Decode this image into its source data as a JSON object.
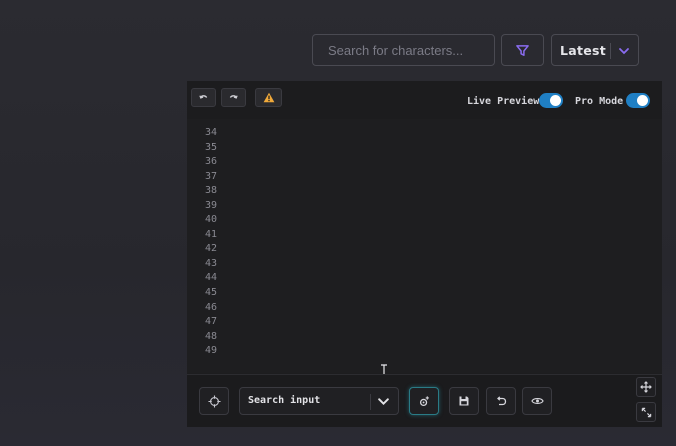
{
  "header": {
    "search": {
      "placeholder": "Search for characters...",
      "value": ""
    },
    "sort": {
      "selected": "Latest"
    }
  },
  "editor": {
    "toolbar": {
      "live_preview_label": "Live Preview",
      "live_preview_on": true,
      "pro_mode_label": "Pro Mode",
      "pro_mode_on": true
    },
    "line_numbers": [
      "34",
      "35",
      "36",
      "37",
      "38",
      "39",
      "40",
      "41",
      "42",
      "43",
      "44",
      "45",
      "46",
      "47",
      "48",
      "49"
    ],
    "bottom": {
      "select_label": "Search input"
    }
  },
  "colors": {
    "accent_purple": "#8a6cf0",
    "toggle_blue": "#1f7fc4",
    "warning_orange": "#f0a93a",
    "active_teal": "#2a7b86"
  },
  "icons": {
    "filter": "filter-icon",
    "chevron": "chevron-down-icon",
    "undo": "undo-icon",
    "redo": "redo-icon",
    "warning": "warning-icon",
    "target": "crosshair-icon",
    "settings": "gear-icon",
    "save": "save-icon",
    "reset": "reset-icon",
    "preview": "eye-icon",
    "move": "move-icon",
    "fullscreen": "expand-icon"
  }
}
